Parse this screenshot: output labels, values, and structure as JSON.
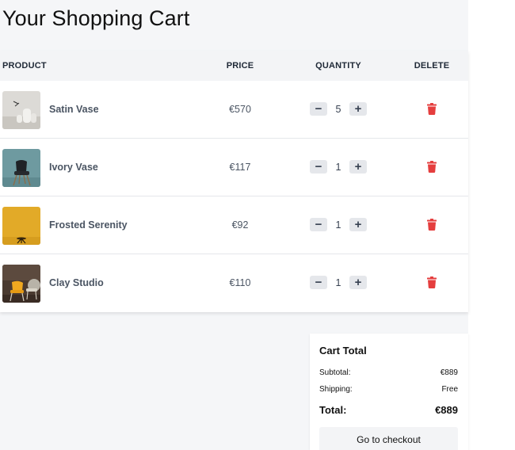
{
  "page": {
    "title": "Your Shopping Cart"
  },
  "table": {
    "headers": {
      "product": "PRODUCT",
      "price": "PRICE",
      "quantity": "QUANTITY",
      "delete": "DELETE"
    },
    "rows": [
      {
        "name": "Satin Vase",
        "price": "€570",
        "quantity": "5",
        "thumbnail": "white-vases-image"
      },
      {
        "name": "Ivory Vase",
        "price": "€117",
        "quantity": "1",
        "thumbnail": "black-chair-image"
      },
      {
        "name": "Frosted Serenity",
        "price": "€92",
        "quantity": "1",
        "thumbnail": "yellow-wall-stool-image"
      },
      {
        "name": "Clay Studio",
        "price": "€110",
        "quantity": "1",
        "thumbnail": "yellow-chair-image"
      }
    ],
    "controls": {
      "minus": "−",
      "plus": "+"
    }
  },
  "summary": {
    "title": "Cart Total",
    "subtotal_label": "Subtotal:",
    "subtotal_value": "€889",
    "shipping_label": "Shipping:",
    "shipping_value": "Free",
    "total_label": "Total:",
    "total_value": "€889",
    "checkout_label": "Go to checkout"
  },
  "colors": {
    "delete": "#e53e3e",
    "header_bg": "#f3f4f6",
    "page_bg": "#f5f6f8"
  }
}
